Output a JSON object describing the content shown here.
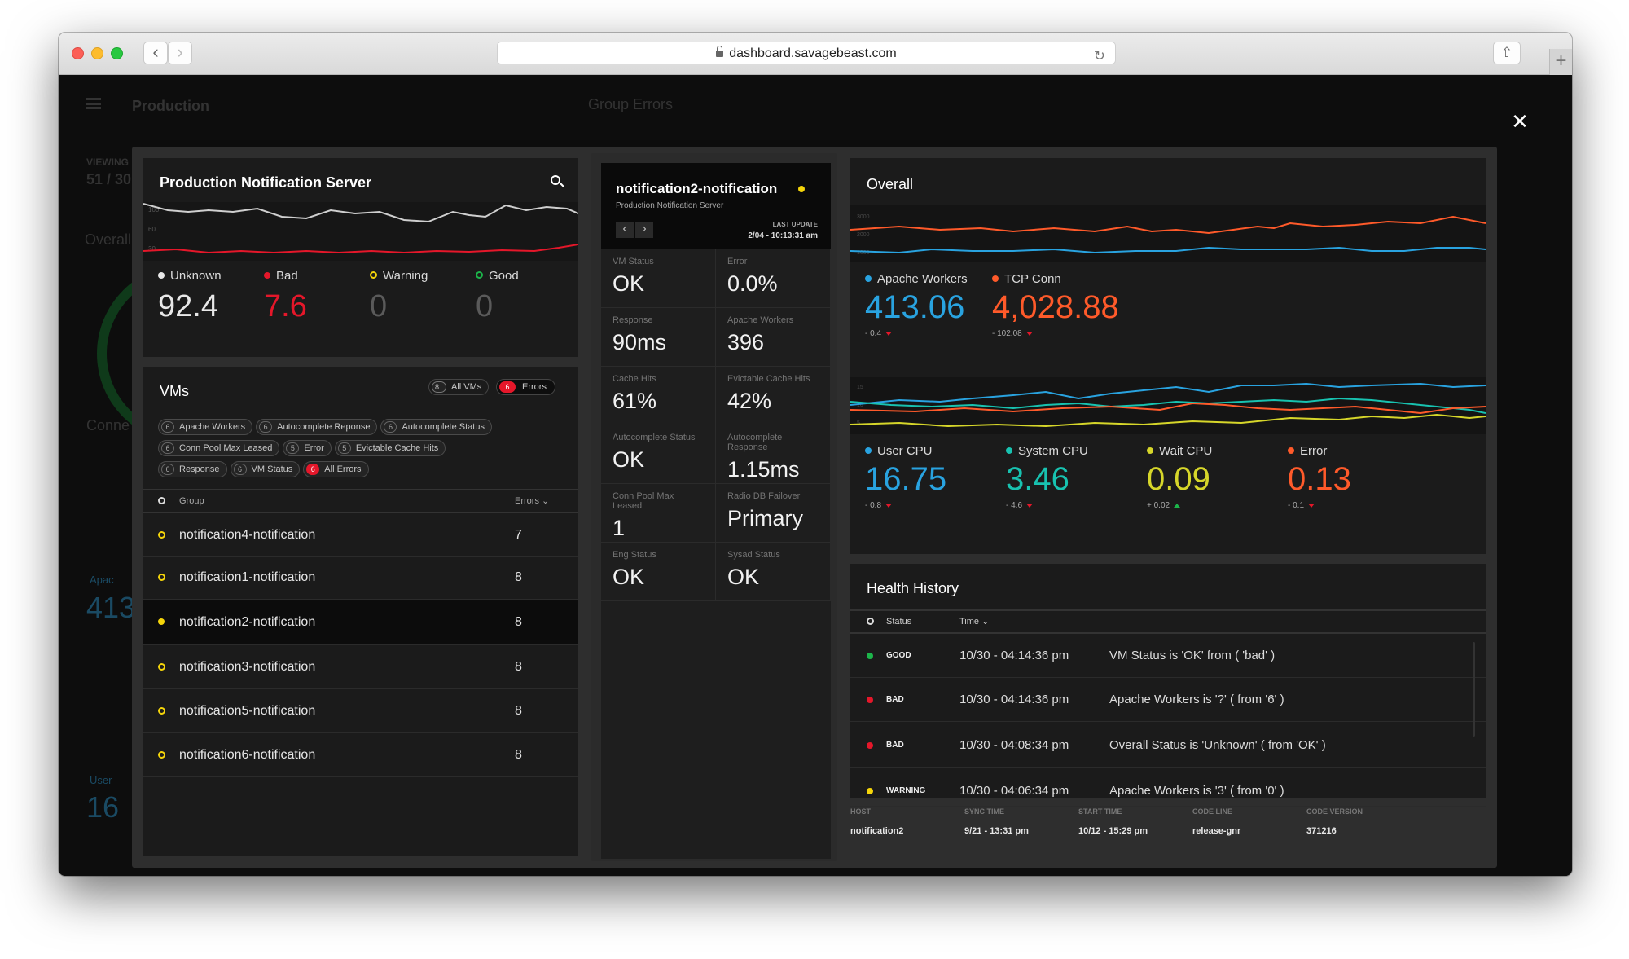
{
  "browser": {
    "url": "dashboard.savagebeast.com"
  },
  "background": {
    "title": "Production",
    "group_title": "Group Errors",
    "viewing_label": "VIEWING",
    "viewing_value": "51 / 30",
    "overall": "Overall",
    "conn": "Conne",
    "apache_partial": "Apac",
    "apache_value": "413",
    "user_partial": "User",
    "user_value": "16"
  },
  "server": {
    "title": "Production Notification Server",
    "legend": [
      {
        "label": "Unknown",
        "value": "92.4",
        "color": "#e8e8e8",
        "style": "dot"
      },
      {
        "label": "Bad",
        "value": "7.6",
        "color": "#e5172a",
        "style": "dot"
      },
      {
        "label": "Warning",
        "value": "0",
        "color": "#f5d50a",
        "style": "ring"
      },
      {
        "label": "Good",
        "value": "0",
        "color": "#1cb54a",
        "style": "ring"
      }
    ],
    "chart_ticks": [
      "100",
      "60",
      "30"
    ]
  },
  "vms": {
    "title": "VMs",
    "all_count": "8",
    "all_label": "All VMs",
    "err_count": "6",
    "err_label": "Errors",
    "tags": [
      {
        "count": "6",
        "label": "Apache Workers"
      },
      {
        "count": "6",
        "label": "Autocomplete Reponse"
      },
      {
        "count": "6",
        "label": "Autocomplete Status"
      },
      {
        "count": "6",
        "label": "Conn Pool Max Leased"
      },
      {
        "count": "5",
        "label": "Error"
      },
      {
        "count": "5",
        "label": "Evictable Cache Hits"
      },
      {
        "count": "6",
        "label": "Response"
      },
      {
        "count": "6",
        "label": "VM Status"
      },
      {
        "count": "6",
        "label": "All Errors",
        "red": true
      }
    ],
    "col_group": "Group",
    "col_errors": "Errors ⌄",
    "rows": [
      {
        "name": "notification4-notification",
        "errors": "7"
      },
      {
        "name": "notification1-notification",
        "errors": "8"
      },
      {
        "name": "notification2-notification",
        "errors": "8",
        "selected": true
      },
      {
        "name": "notification3-notification",
        "errors": "8"
      },
      {
        "name": "notification5-notification",
        "errors": "8"
      },
      {
        "name": "notification6-notification",
        "errors": "8"
      }
    ]
  },
  "detail": {
    "title": "notification2-notification",
    "subtitle": "Production Notification Server",
    "last_update_label": "LAST UPDATE",
    "last_update": "2/04 - 10:13:31 am",
    "metrics": [
      {
        "label": "VM Status",
        "value": "OK"
      },
      {
        "label": "Error",
        "value": "0.0%"
      },
      {
        "label": "Response",
        "value": "90ms"
      },
      {
        "label": "Apache Workers",
        "value": "396"
      },
      {
        "label": "Cache Hits",
        "value": "61%"
      },
      {
        "label": "Evictable Cache Hits",
        "value": "42%"
      },
      {
        "label": "Autocomplete Status",
        "value": "OK"
      },
      {
        "label": "Autocomplete Response",
        "value": "1.15ms"
      },
      {
        "label": "Conn Pool Max Leased",
        "value": "1"
      },
      {
        "label": "Radio DB Failover",
        "value": "Primary"
      },
      {
        "label": "Eng Status",
        "value": "OK"
      },
      {
        "label": "Sysad Status",
        "value": "OK"
      }
    ]
  },
  "overall": {
    "title": "Overall",
    "ticks": [
      "3000",
      "2000",
      "1000"
    ],
    "ticks2": [
      "15",
      "10",
      "5"
    ],
    "top": [
      {
        "label": "Apache Workers",
        "value": "413.06",
        "delta": "- 0.4",
        "color": "#29a3e0",
        "trend": "down"
      },
      {
        "label": "TCP Conn",
        "value": "4,028.88",
        "delta": "- 102.08",
        "color": "#ff5a2a",
        "trend": "down"
      }
    ],
    "bottom": [
      {
        "label": "User CPU",
        "value": "16.75",
        "delta": "- 0.8",
        "color": "#29a3e0",
        "trend": "down"
      },
      {
        "label": "System CPU",
        "value": "3.46",
        "delta": "- 4.6",
        "color": "#18c2b0",
        "trend": "down"
      },
      {
        "label": "Wait CPU",
        "value": "0.09",
        "delta": "+ 0.02",
        "color": "#d6d62a",
        "trend": "up"
      },
      {
        "label": "Error",
        "value": "0.13",
        "delta": "- 0.1",
        "color": "#ff5a2a",
        "trend": "down"
      }
    ]
  },
  "health": {
    "title": "Health History",
    "col_status": "Status",
    "col_time": "Time ⌄",
    "rows": [
      {
        "status": "GOOD",
        "color": "#1cb54a",
        "time": "10/30 - 04:14:36 pm",
        "msg": "VM Status is 'OK' from ( 'bad' )"
      },
      {
        "status": "BAD",
        "color": "#e5172a",
        "time": "10/30 - 04:14:36 pm",
        "msg": "Apache Workers is '?' ( from '6' )"
      },
      {
        "status": "BAD",
        "color": "#e5172a",
        "time": "10/30 - 04:08:34 pm",
        "msg": "Overall Status is 'Unknown' ( from 'OK' )"
      },
      {
        "status": "WARNING",
        "color": "#f5d50a",
        "time": "10/30 - 04:06:34 pm",
        "msg": "Apache Workers is '3' ( from '0' )"
      }
    ]
  },
  "footer": [
    {
      "label": "HOST",
      "value": "notification2"
    },
    {
      "label": "SYNC TIME",
      "value": "9/21 - 13:31 pm"
    },
    {
      "label": "START TIME",
      "value": "10/12 - 15:29 pm"
    },
    {
      "label": "CODE LINE",
      "value": "release-gnr"
    },
    {
      "label": "CODE VERSION",
      "value": "371216"
    }
  ]
}
